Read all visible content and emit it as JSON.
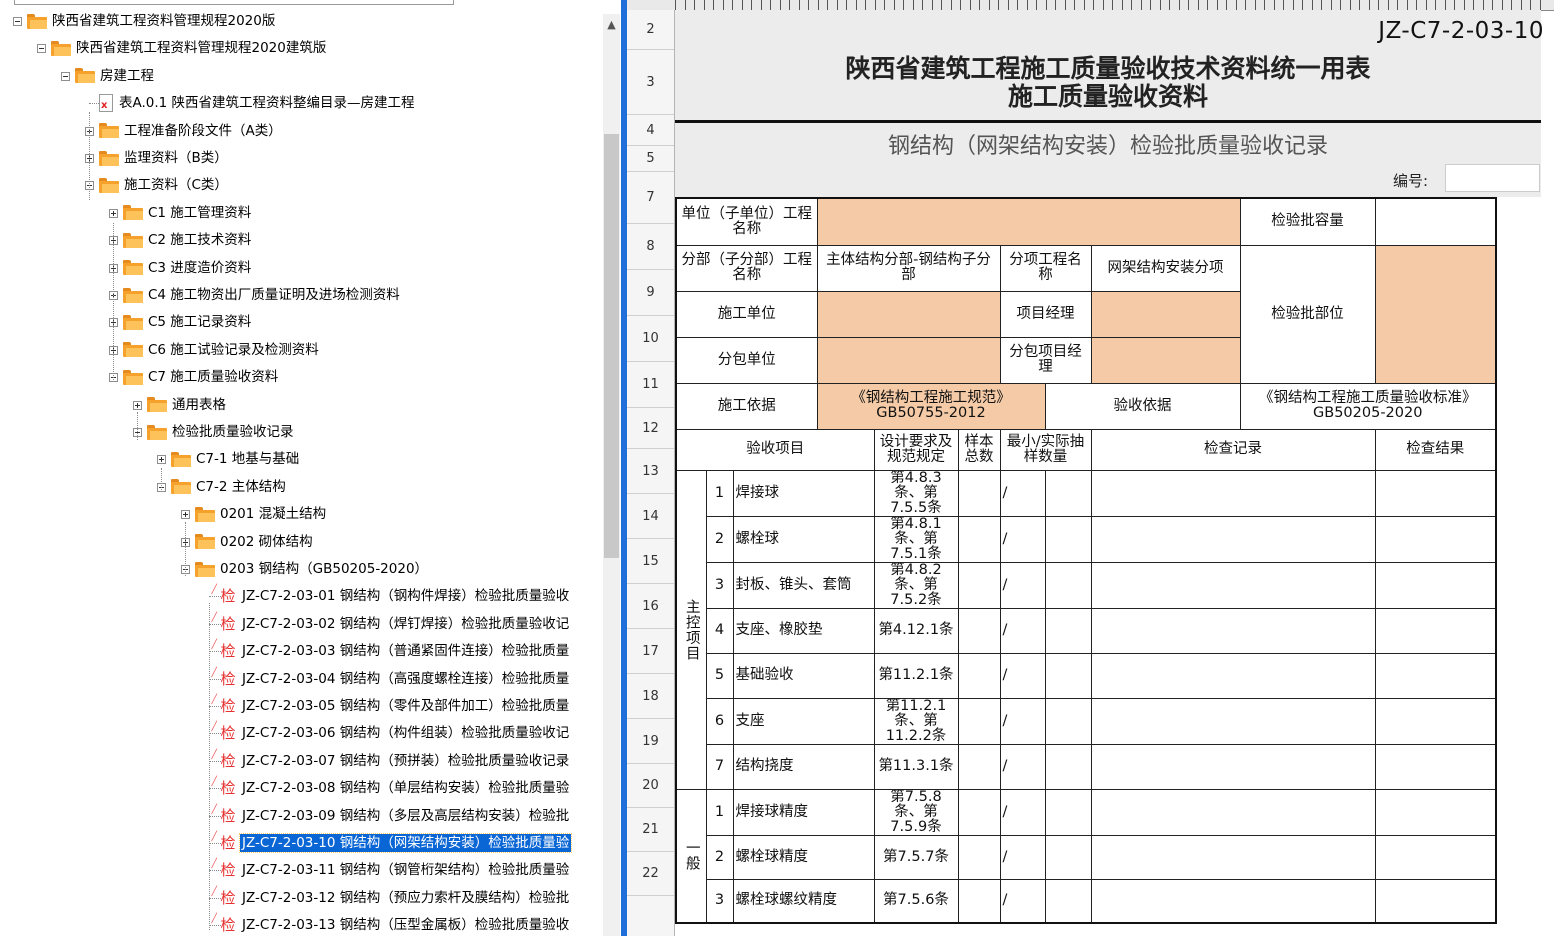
{
  "tree": {
    "items": [
      {
        "label": "陕西省建筑工程资料管理规程2020版",
        "icon": "folder-open-icon"
      },
      {
        "label": "陕西省建筑工程资料管理规程2020建筑版",
        "icon": "folder-open-icon"
      },
      {
        "label": "房建工程",
        "icon": "folder-open-icon"
      },
      {
        "label": "表A.0.1 陕西省建筑工程资料整编目录—房建工程",
        "icon": "document-x-icon"
      },
      {
        "label": "工程准备阶段文件（A类）",
        "icon": "folder-icon"
      },
      {
        "label": "监理资料（B类）",
        "icon": "folder-icon"
      },
      {
        "label": "施工资料（C类）",
        "icon": "folder-open-icon"
      },
      {
        "label": "C1 施工管理资料",
        "icon": "folder-icon"
      },
      {
        "label": "C2 施工技术资料",
        "icon": "folder-icon"
      },
      {
        "label": "C3 进度造价资料",
        "icon": "folder-icon"
      },
      {
        "label": "C4 施工物资出厂质量证明及进场检测资料",
        "icon": "folder-icon"
      },
      {
        "label": "C5 施工记录资料",
        "icon": "folder-icon"
      },
      {
        "label": "C6 施工试验记录及检测资料",
        "icon": "folder-icon"
      },
      {
        "label": "C7 施工质量验收资料",
        "icon": "folder-open-icon"
      },
      {
        "label": "通用表格",
        "icon": "folder-icon"
      },
      {
        "label": "检验批质量验收记录",
        "icon": "folder-open-icon"
      },
      {
        "label": "C7-1 地基与基础",
        "icon": "folder-icon"
      },
      {
        "label": "C7-2 主体结构",
        "icon": "folder-open-icon"
      },
      {
        "label": "0201 混凝土结构",
        "icon": "folder-icon"
      },
      {
        "label": "0202 砌体结构",
        "icon": "folder-icon"
      },
      {
        "label": "0203 钢结构（GB50205-2020）",
        "icon": "folder-open-icon"
      },
      {
        "label": "JZ-C7-2-03-01 钢结构（钢构件焊接）检验批质量验收",
        "icon": "jian-icon"
      },
      {
        "label": "JZ-C7-2-03-02 钢结构（焊钉焊接）检验批质量验收记",
        "icon": "jian-icon"
      },
      {
        "label": "JZ-C7-2-03-03 钢结构（普通紧固件连接）检验批质量",
        "icon": "jian-icon"
      },
      {
        "label": "JZ-C7-2-03-04 钢结构（高强度螺栓连接）检验批质量",
        "icon": "jian-icon"
      },
      {
        "label": "JZ-C7-2-03-05 钢结构（零件及部件加工）检验批质量",
        "icon": "jian-icon"
      },
      {
        "label": "JZ-C7-2-03-06 钢结构（构件组装）检验批质量验收记",
        "icon": "jian-icon"
      },
      {
        "label": "JZ-C7-2-03-07 钢结构（预拼装）检验批质量验收记录",
        "icon": "jian-icon"
      },
      {
        "label": "JZ-C7-2-03-08 钢结构（单层结构安装）检验批质量验",
        "icon": "jian-icon"
      },
      {
        "label": "JZ-C7-2-03-09 钢结构（多层及高层结构安装）检验批",
        "icon": "jian-icon"
      },
      {
        "label": "JZ-C7-2-03-10 钢结构（网架结构安装）检验批质量验",
        "icon": "jian-icon"
      },
      {
        "label": "JZ-C7-2-03-11 钢结构（钢管桁架结构）检验批质量验",
        "icon": "jian-icon"
      },
      {
        "label": "JZ-C7-2-03-12 钢结构（预应力索杆及膜结构）检验批",
        "icon": "jian-icon"
      },
      {
        "label": "JZ-C7-2-03-13 钢结构（压型金属板）检验批质量验收",
        "icon": "jian-icon"
      }
    ],
    "jian_glyph": "检"
  },
  "sheet": {
    "row_numbers": [
      "2",
      "3",
      "4",
      "5",
      "7",
      "8",
      "9",
      "10",
      "11",
      "12",
      "13",
      "14",
      "15",
      "16",
      "17",
      "18",
      "19",
      "20",
      "21",
      "22"
    ],
    "doc_code": "JZ-C7-2-03-10",
    "title_line1": "陕西省建筑工程施工质量验收技术资料统一用表",
    "title_line2": "施工质量验收资料",
    "subtitle": "钢结构（网架结构安装）检验批质量验收记录",
    "bianhao_label": "编号:",
    "labels": {
      "unit_name": "单位（子单位）工程名称",
      "batch_capacity": "检验批容量",
      "division_name": "分部（子分部）工程名称",
      "division_value": "主体结构分部-钢结构子分部",
      "subitem_name": "分项工程名称",
      "subitem_value": "网架结构安装分项",
      "batch_location": "检验批部位",
      "construction_unit": "施工单位",
      "project_manager": "项目经理",
      "sub_unit": "分包单位",
      "sub_manager": "分包项目经理",
      "construction_basis": "施工依据",
      "construction_basis_value": "《钢结构工程施工规范》GB50755-2012",
      "acceptance_basis": "验收依据",
      "acceptance_basis_value": "《钢结构工程施工质量验收标准》GB50205-2020"
    },
    "headers": {
      "item": "验收项目",
      "design": "设计要求及规范规定",
      "sample_total": "样本总数",
      "min_actual": "最小/实际抽样数量",
      "check_record": "检查记录",
      "check_result": "检查结果"
    },
    "main_group_label": "主控项目",
    "general_group_label": "一般",
    "slash": "/",
    "main_items": [
      {
        "no": "1",
        "name": "焊接球",
        "clause": "第4.8.3条、第7.5.5条"
      },
      {
        "no": "2",
        "name": "螺栓球",
        "clause": "第4.8.1条、第7.5.1条"
      },
      {
        "no": "3",
        "name": "封板、锥头、套筒",
        "clause": "第4.8.2条、第7.5.2条"
      },
      {
        "no": "4",
        "name": "支座、橡胶垫",
        "clause": "第4.12.1条"
      },
      {
        "no": "5",
        "name": "基础验收",
        "clause": "第11.2.1条"
      },
      {
        "no": "6",
        "name": "支座",
        "clause": "第11.2.1条、第11.2.2条"
      },
      {
        "no": "7",
        "name": "结构挠度",
        "clause": "第11.3.1条"
      }
    ],
    "general_items": [
      {
        "no": "1",
        "name": "焊接球精度",
        "clause": "第7.5.8条、第7.5.9条"
      },
      {
        "no": "2",
        "name": "螺栓球精度",
        "clause": "第7.5.7条"
      },
      {
        "no": "3",
        "name": "螺栓球螺纹精度",
        "clause": "第7.5.6条"
      }
    ]
  },
  "colors": {
    "fill": "#f5cba7",
    "selection": "#0a66d4",
    "splitter": "#1e6fd8"
  }
}
